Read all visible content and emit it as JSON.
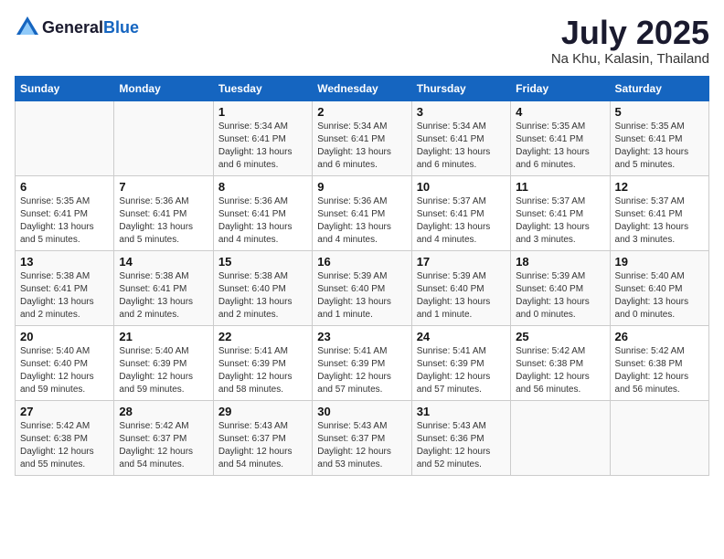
{
  "logo": {
    "text_general": "General",
    "text_blue": "Blue"
  },
  "title": "July 2025",
  "location": "Na Khu, Kalasin, Thailand",
  "weekdays": [
    "Sunday",
    "Monday",
    "Tuesday",
    "Wednesday",
    "Thursday",
    "Friday",
    "Saturday"
  ],
  "weeks": [
    [
      {
        "day": "",
        "info": ""
      },
      {
        "day": "",
        "info": ""
      },
      {
        "day": "1",
        "info": "Sunrise: 5:34 AM\nSunset: 6:41 PM\nDaylight: 13 hours\nand 6 minutes."
      },
      {
        "day": "2",
        "info": "Sunrise: 5:34 AM\nSunset: 6:41 PM\nDaylight: 13 hours\nand 6 minutes."
      },
      {
        "day": "3",
        "info": "Sunrise: 5:34 AM\nSunset: 6:41 PM\nDaylight: 13 hours\nand 6 minutes."
      },
      {
        "day": "4",
        "info": "Sunrise: 5:35 AM\nSunset: 6:41 PM\nDaylight: 13 hours\nand 6 minutes."
      },
      {
        "day": "5",
        "info": "Sunrise: 5:35 AM\nSunset: 6:41 PM\nDaylight: 13 hours\nand 5 minutes."
      }
    ],
    [
      {
        "day": "6",
        "info": "Sunrise: 5:35 AM\nSunset: 6:41 PM\nDaylight: 13 hours\nand 5 minutes."
      },
      {
        "day": "7",
        "info": "Sunrise: 5:36 AM\nSunset: 6:41 PM\nDaylight: 13 hours\nand 5 minutes."
      },
      {
        "day": "8",
        "info": "Sunrise: 5:36 AM\nSunset: 6:41 PM\nDaylight: 13 hours\nand 4 minutes."
      },
      {
        "day": "9",
        "info": "Sunrise: 5:36 AM\nSunset: 6:41 PM\nDaylight: 13 hours\nand 4 minutes."
      },
      {
        "day": "10",
        "info": "Sunrise: 5:37 AM\nSunset: 6:41 PM\nDaylight: 13 hours\nand 4 minutes."
      },
      {
        "day": "11",
        "info": "Sunrise: 5:37 AM\nSunset: 6:41 PM\nDaylight: 13 hours\nand 3 minutes."
      },
      {
        "day": "12",
        "info": "Sunrise: 5:37 AM\nSunset: 6:41 PM\nDaylight: 13 hours\nand 3 minutes."
      }
    ],
    [
      {
        "day": "13",
        "info": "Sunrise: 5:38 AM\nSunset: 6:41 PM\nDaylight: 13 hours\nand 2 minutes."
      },
      {
        "day": "14",
        "info": "Sunrise: 5:38 AM\nSunset: 6:41 PM\nDaylight: 13 hours\nand 2 minutes."
      },
      {
        "day": "15",
        "info": "Sunrise: 5:38 AM\nSunset: 6:40 PM\nDaylight: 13 hours\nand 2 minutes."
      },
      {
        "day": "16",
        "info": "Sunrise: 5:39 AM\nSunset: 6:40 PM\nDaylight: 13 hours\nand 1 minute."
      },
      {
        "day": "17",
        "info": "Sunrise: 5:39 AM\nSunset: 6:40 PM\nDaylight: 13 hours\nand 1 minute."
      },
      {
        "day": "18",
        "info": "Sunrise: 5:39 AM\nSunset: 6:40 PM\nDaylight: 13 hours\nand 0 minutes."
      },
      {
        "day": "19",
        "info": "Sunrise: 5:40 AM\nSunset: 6:40 PM\nDaylight: 13 hours\nand 0 minutes."
      }
    ],
    [
      {
        "day": "20",
        "info": "Sunrise: 5:40 AM\nSunset: 6:40 PM\nDaylight: 12 hours\nand 59 minutes."
      },
      {
        "day": "21",
        "info": "Sunrise: 5:40 AM\nSunset: 6:39 PM\nDaylight: 12 hours\nand 59 minutes."
      },
      {
        "day": "22",
        "info": "Sunrise: 5:41 AM\nSunset: 6:39 PM\nDaylight: 12 hours\nand 58 minutes."
      },
      {
        "day": "23",
        "info": "Sunrise: 5:41 AM\nSunset: 6:39 PM\nDaylight: 12 hours\nand 57 minutes."
      },
      {
        "day": "24",
        "info": "Sunrise: 5:41 AM\nSunset: 6:39 PM\nDaylight: 12 hours\nand 57 minutes."
      },
      {
        "day": "25",
        "info": "Sunrise: 5:42 AM\nSunset: 6:38 PM\nDaylight: 12 hours\nand 56 minutes."
      },
      {
        "day": "26",
        "info": "Sunrise: 5:42 AM\nSunset: 6:38 PM\nDaylight: 12 hours\nand 56 minutes."
      }
    ],
    [
      {
        "day": "27",
        "info": "Sunrise: 5:42 AM\nSunset: 6:38 PM\nDaylight: 12 hours\nand 55 minutes."
      },
      {
        "day": "28",
        "info": "Sunrise: 5:42 AM\nSunset: 6:37 PM\nDaylight: 12 hours\nand 54 minutes."
      },
      {
        "day": "29",
        "info": "Sunrise: 5:43 AM\nSunset: 6:37 PM\nDaylight: 12 hours\nand 54 minutes."
      },
      {
        "day": "30",
        "info": "Sunrise: 5:43 AM\nSunset: 6:37 PM\nDaylight: 12 hours\nand 53 minutes."
      },
      {
        "day": "31",
        "info": "Sunrise: 5:43 AM\nSunset: 6:36 PM\nDaylight: 12 hours\nand 52 minutes."
      },
      {
        "day": "",
        "info": ""
      },
      {
        "day": "",
        "info": ""
      }
    ]
  ]
}
